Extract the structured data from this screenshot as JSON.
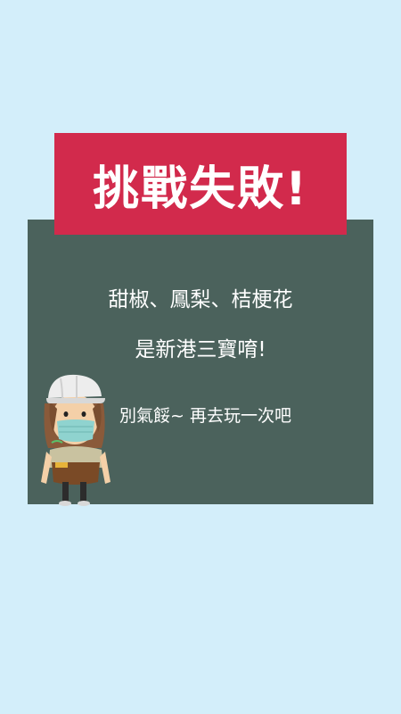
{
  "banner": {
    "title": "挑戰失敗!"
  },
  "message": {
    "line1": "甜椒、鳳梨、桔梗花",
    "line2": "是新港三寶唷!",
    "retry_text": "別氣餒~ 再去玩一次吧"
  },
  "colors": {
    "background": "#d3eefa",
    "banner": "#d22a4c",
    "board": "#4b625c",
    "text": "#ffffff"
  },
  "character": {
    "icon": "farmer-girl-with-mask-icon"
  }
}
